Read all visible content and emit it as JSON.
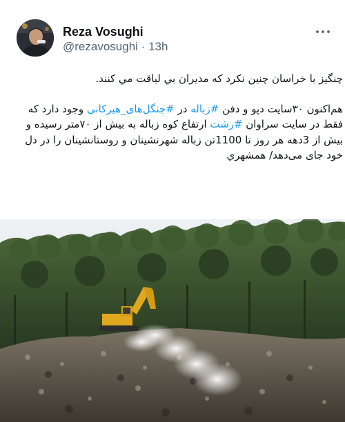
{
  "tweet": {
    "author_name": "Reza Vosughi",
    "handle": "@rezavosughi",
    "separator": "·",
    "time": "13h",
    "line1": "چنگیز با خراسان چنین نکرد که مدیران بي لياقت مي كنند.",
    "p2_part1": "هم‌اکنون ۳۰سایت دپو و دفن ",
    "hashtag1": "#زباله",
    "p2_part2": " در ",
    "hashtag2": "#جنگل‌های_هیرکانی",
    "p2_part3": " وجود دارد که فقط در سایت سراوان ",
    "hashtag3": "#رشت",
    "p2_part4": " ارتفاع کوه زباله به بیش از ۷۰متر رسیده و بیش از 3دهه هر روز تا 1100تن زباله شهرنشینان و روستانشینان را در دل خود جای می‌دهد/ همشهري"
  },
  "colors": {
    "text": "#0f1419",
    "secondary": "#536471",
    "link": "#1d9bf0"
  },
  "icons": {
    "more": "more-options-icon"
  }
}
